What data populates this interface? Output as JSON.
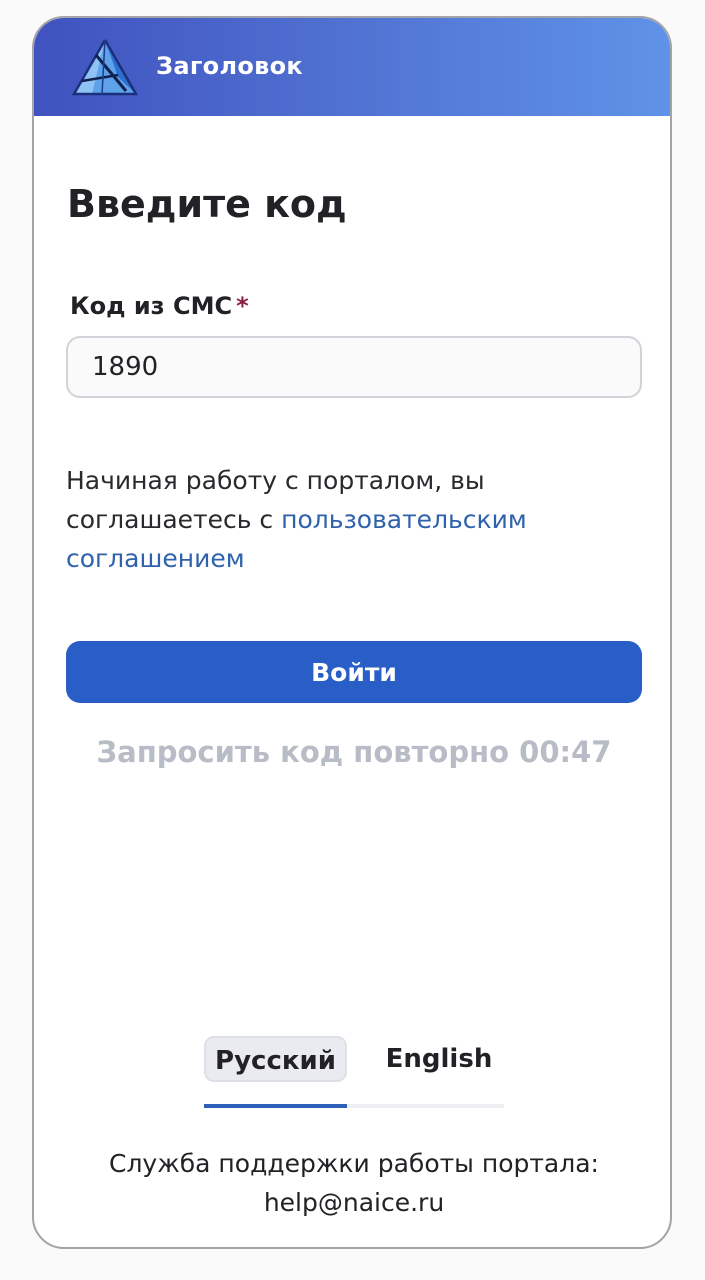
{
  "header": {
    "title": "Заголовок",
    "logo_icon": "triangle-logo-icon",
    "gradient_start": "#3f52bf",
    "gradient_end": "#5f93e8"
  },
  "form": {
    "title": "Введите код",
    "code_label": "Код из СМС",
    "required_mark": "*",
    "code_value": "1890",
    "agreement_text": "Начиная работу с порталом, вы соглашаетесь с ",
    "agreement_link": "пользовательским соглашением",
    "submit_label": "Войти",
    "resend_label": "Запросить код повторно",
    "resend_timer": "00:47"
  },
  "languages": {
    "items": [
      {
        "label": "Русский",
        "active": true
      },
      {
        "label": "English",
        "active": false
      }
    ]
  },
  "footer": {
    "support_text": "Служба поддержки работы портала:",
    "support_email": "help@naice.ru"
  },
  "colors": {
    "primary": "#285ec5",
    "link": "#2f62ad",
    "required": "#8b1f3f",
    "disabled_text": "#b8bcc6"
  }
}
